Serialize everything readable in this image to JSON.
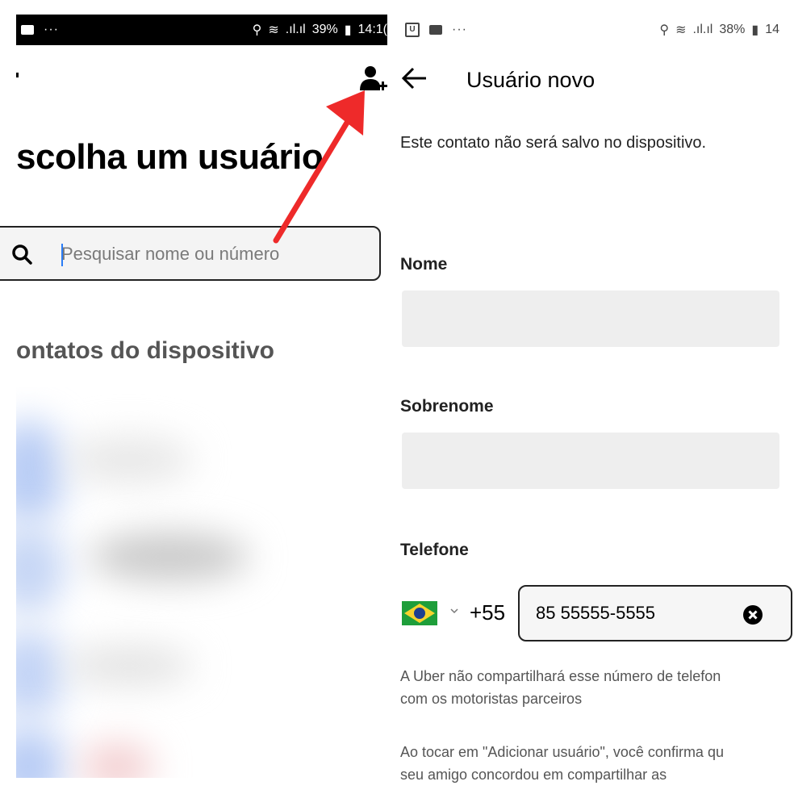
{
  "left_screen": {
    "status_bar": {
      "battery": "39%",
      "time": "14:1("
    },
    "title": "scolha um usuário",
    "search": {
      "placeholder": "Pesquisar nome ou número"
    },
    "section_title": "ontatos do dispositivo"
  },
  "right_screen": {
    "status_bar": {
      "app_badge": "U",
      "battery": "38%",
      "time": "14"
    },
    "title": "Usuário novo",
    "info": "Este contato não será salvo no dispositivo.",
    "fields": {
      "first_name_label": "Nome",
      "last_name_label": "Sobrenome",
      "phone_label": "Telefone"
    },
    "phone": {
      "country_code": "+55",
      "value": "85 55555-5555"
    },
    "note_1_line1": "A Uber não compartilhará esse número de telefon",
    "note_1_line2": "com os motoristas parceiros",
    "note_2_line1": "Ao tocar em \"Adicionar usuário\", você confirma qu",
    "note_2_line2": "seu amigo concordou em compartilhar as"
  },
  "colors": {
    "annotation_arrow": "#ee2a2a",
    "cursor": "#2a7cf6",
    "field_background": "#eeeeee"
  },
  "icons": [
    "add-user-icon",
    "search-icon",
    "back-arrow-icon",
    "brazil-flag-icon",
    "chevron-down-icon",
    "clear-icon",
    "location-icon",
    "wifi-icon",
    "signal-icon",
    "battery-icon"
  ]
}
